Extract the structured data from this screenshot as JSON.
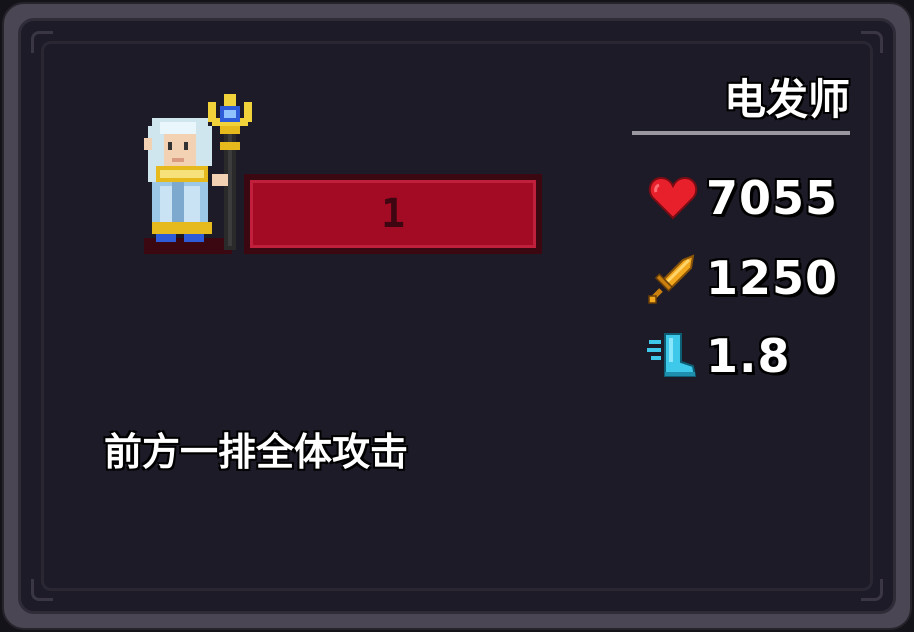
{
  "unit": {
    "name": "电发师",
    "level": "1",
    "skill_description": "前方一排全体攻击"
  },
  "stats": {
    "hp": {
      "icon": "heart-icon",
      "value": "7055",
      "color": "#e8202c"
    },
    "attack": {
      "icon": "sword-icon",
      "value": "1250",
      "color": "#f2a81e"
    },
    "speed": {
      "icon": "boot-icon",
      "value": "1.8",
      "color": "#3ec8ea"
    }
  },
  "colors": {
    "panel_background": "#1d1b27",
    "frame": "#4a4653",
    "level_bar": "#a30b24",
    "text": "#ffffff"
  }
}
